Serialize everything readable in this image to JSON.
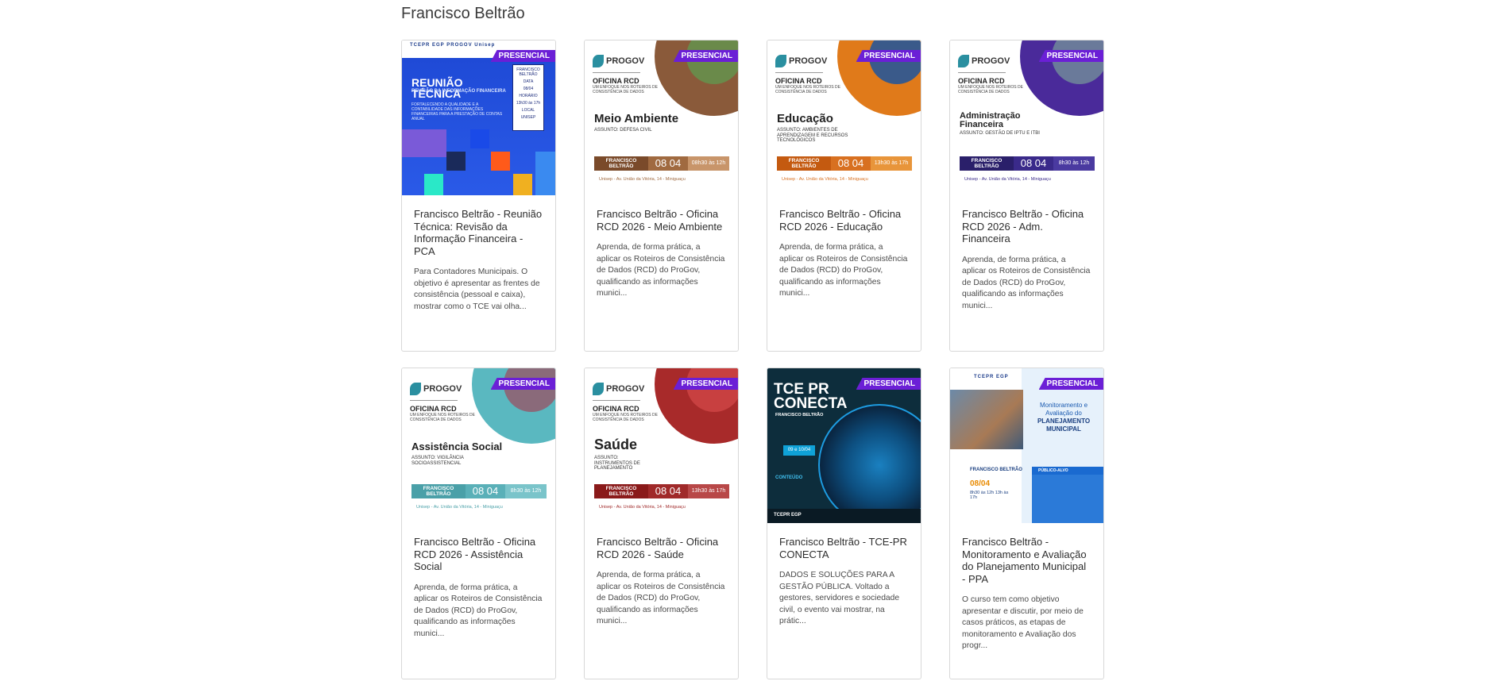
{
  "section": {
    "title": "Francisco Beltrão"
  },
  "badge_label": "PRESENCIAL",
  "colors": {
    "badge": "#6b1fd6",
    "card_border": "#d8d8d8",
    "title_text": "#2d2d2d"
  },
  "cards": [
    {
      "title": "Francisco Beltrão - Reunião Técnica: Revisão da Informação Financeira - PCA",
      "description": "Para Contadores Municipais. O objetivo é apresentar as frentes de consistência (pessoal e caixa), mostrar como o TCE vai olha...",
      "thumb": {
        "heading": "REUNIÃO TÉCNICA",
        "subheading": "REVISÃO DA INFORMAÇÃO FINANCEIRA",
        "text": "FORTALECENDO A QUALIDADE E A CONTABILIDADE DAS INFORMAÇÕES FINANCEIRAS PARA A PRESTAÇÃO DE CONTAS ANUAL",
        "box_city": "FRANCISCO BELTRÃO",
        "box_date_label": "DATA",
        "box_date": "08/04",
        "box_time_label": "HORÁRIO",
        "box_time": "13h30 às 17h",
        "box_place_label": "LOCAL",
        "box_place": "UNISEP",
        "logos": "TCEPR EGP PROGOV Unisep"
      }
    },
    {
      "title": "Francisco Beltrão - Oficina RCD 2026 - Meio Ambiente",
      "description": "Aprenda, de forma prática, a aplicar os Roteiros de Consistência de Dados (RCD) do ProGov, qualificando as informações munici...",
      "thumb": {
        "logo": "PROGOV",
        "oficina": "OFICINA RCD",
        "enfoque": "UM ENFOQUE NOS ROTEIROS DE CONSISTÊNCIA DE DADOS",
        "subject": "Meio Ambiente",
        "assunto": "ASSUNTO: DEFESA CIVIL",
        "city": "FRANCISCO BELTRÃO",
        "date": "08 04",
        "time": "08h30 às 12h",
        "footer": "Unisep - Av. União da Vitória, 14 - Miniguaçu",
        "color": "#7a4a2a",
        "gear": "#8a5a3a"
      }
    },
    {
      "title": "Francisco Beltrão - Oficina RCD 2026 - Educação",
      "description": "Aprenda, de forma prática, a aplicar os Roteiros de Consistência de Dados (RCD) do ProGov, qualificando as informações munici...",
      "thumb": {
        "logo": "PROGOV",
        "oficina": "OFICINA RCD",
        "enfoque": "UM ENFOQUE NOS ROTEIROS DE CONSISTÊNCIA DE DADOS",
        "subject": "Educação",
        "assunto": "ASSUNTO: AMBIENTES DE APRENDIZAGEM E RECURSOS TECNOLÓGICOS",
        "city": "FRANCISCO BELTRÃO",
        "date": "08 04",
        "time": "13h30 às 17h",
        "footer": "Unisep - Av. União da Vitória, 14 - Miniguaçu",
        "color": "#c45a10",
        "gear": "#e07a1a"
      }
    },
    {
      "title": "Francisco Beltrão - Oficina RCD 2026 - Adm. Financeira",
      "description": "Aprenda, de forma prática, a aplicar os Roteiros de Consistência de Dados (RCD) do ProGov, qualificando as informações munici...",
      "thumb": {
        "logo": "PROGOV",
        "oficina": "OFICINA RCD",
        "enfoque": "UM ENFOQUE NOS ROTEIROS DE CONSISTÊNCIA DE DADOS",
        "subject": "Administração Financeira",
        "assunto": "ASSUNTO: GESTÃO DE IPTU E ITBI",
        "city": "FRANCISCO BELTRÃO",
        "date": "08 04",
        "time": "8h30 às 12h",
        "footer": "Unisep - Av. União da Vitória, 14 - Miniguaçu",
        "color": "#2a1f6a",
        "gear": "#4a2a9a"
      }
    },
    {
      "title": "Francisco Beltrão - Oficina RCD 2026 - Assistência Social",
      "description": "Aprenda, de forma prática, a aplicar os Roteiros de Consistência de Dados (RCD) do ProGov, qualificando as informações munici...",
      "thumb": {
        "logo": "PROGOV",
        "oficina": "OFICINA RCD",
        "enfoque": "UM ENFOQUE NOS ROTEIROS DE CONSISTÊNCIA DE DADOS",
        "subject": "Assistência Social",
        "assunto": "ASSUNTO: VIGILÂNCIA SOCIOASSISTENCIAL",
        "city": "FRANCISCO BELTRÃO",
        "date": "08 04",
        "time": "8h30 às 12h",
        "footer": "Unisep - Av. União da Vitória, 14 - Miniguaçu",
        "color": "#4aa0a8",
        "gear": "#5ab8c0"
      }
    },
    {
      "title": "Francisco Beltrão - Oficina RCD 2026 - Saúde",
      "description": "Aprenda, de forma prática, a aplicar os Roteiros de Consistência de Dados (RCD) do ProGov, qualificando as informações munici...",
      "thumb": {
        "logo": "PROGOV",
        "oficina": "OFICINA RCD",
        "enfoque": "UM ENFOQUE NOS ROTEIROS DE CONSISTÊNCIA DE DADOS",
        "subject": "Saúde",
        "assunto": "ASSUNTO: INSTRUMENTOS DE PLANEJAMENTO",
        "city": "FRANCISCO BELTRÃO",
        "date": "08 04",
        "time": "13h30 às 17h",
        "footer": "Unisep - Av. União da Vitória, 14 - Miniguaçu",
        "color": "#8a1a1a",
        "gear": "#a82a2a"
      }
    },
    {
      "title": "Francisco Beltrão - TCE-PR CONECTA",
      "description": "DADOS E SOLUÇÕES PARA A GESTÃO PÚBLICA. Voltado a gestores, servidores e sociedade civil, o evento vai mostrar, na prátic...",
      "thumb": {
        "logo_line1": "TCE PR",
        "logo_line2": "CONECTA",
        "city": "FRANCISCO BELTRÃO",
        "date": "09 e 10/04",
        "conteudo": "CONTEÚDO",
        "footer": "TCEPR EGP"
      }
    },
    {
      "title": "Francisco Beltrão - Monitoramento e Avaliação do Planejamento Municipal - PPA",
      "description": "O curso tem como objetivo apresentar e discutir, por meio de casos práticos, as etapas de monitoramento e Avaliação dos progr...",
      "thumb": {
        "logos": "TCEPR EGP",
        "title_a": "Monitoramento e Avaliação do",
        "title_b": "PLANEJAMENTO MUNICIPAL",
        "city": "FRANCISCO BELTRÃO",
        "date": "08/04",
        "time": "8h30 às 12h 13h às 17h",
        "publico": "PÚBLICO-ALVO"
      }
    }
  ]
}
